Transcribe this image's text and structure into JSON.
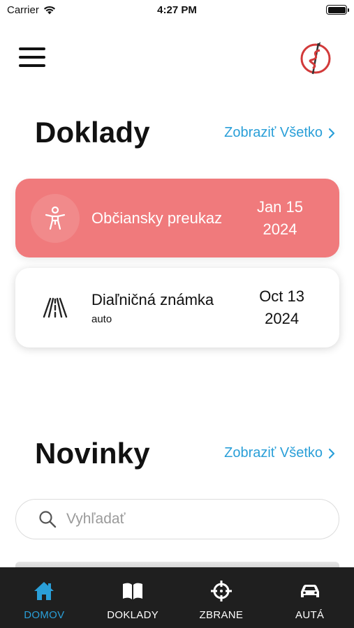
{
  "status_bar": {
    "carrier": "Carrier",
    "time": "4:27 PM"
  },
  "header": {
    "menu_icon": "hamburger-menu-icon",
    "logo_icon": "caduceus-logo"
  },
  "documents": {
    "title": "Doklady",
    "see_all": "Zobraziť Všetko",
    "cards": [
      {
        "title": "Občiansky preukaz",
        "subtitle": "",
        "date_line1": "Jan 15",
        "date_line2": "2024",
        "icon": "person-icon",
        "color": "#f07a7c"
      },
      {
        "title": "Diaľničná známka",
        "subtitle": "auto",
        "date_line1": "Oct 13",
        "date_line2": "2024",
        "icon": "road-icon",
        "color": "#ffffff"
      }
    ]
  },
  "news": {
    "title": "Novinky",
    "see_all": "Zobraziť Všetko"
  },
  "search": {
    "placeholder": "Vyhľadať",
    "value": ""
  },
  "tab_bar": {
    "tabs": [
      {
        "label": "DOMOV",
        "icon": "home-icon",
        "active": true
      },
      {
        "label": "DOKLADY",
        "icon": "book-icon",
        "active": false
      },
      {
        "label": "ZBRANE",
        "icon": "crosshair-icon",
        "active": false
      },
      {
        "label": "AUTÁ",
        "icon": "car-icon",
        "active": false
      }
    ]
  },
  "colors": {
    "accent": "#2a9fd8",
    "id_card": "#f07a7c",
    "tab_bar_bg": "#1f1f1f"
  }
}
